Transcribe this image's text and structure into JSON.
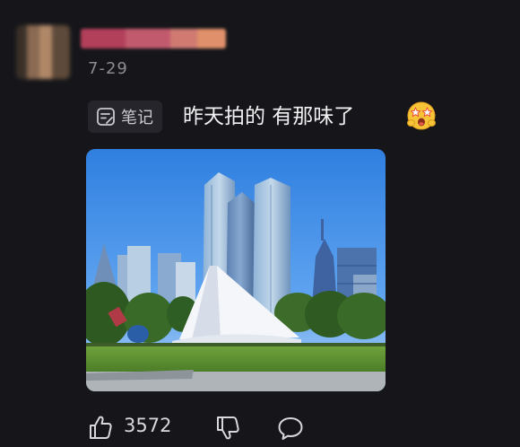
{
  "comment": {
    "date": "7-29",
    "tag_label": "笔记",
    "text": "昨天拍的 有那味了",
    "emoji": "star-struck-emoji"
  },
  "actions": {
    "like_count": "3572"
  },
  "colors": {
    "background": "#16161a",
    "tag_background": "#25252b",
    "text": "#f1f1f3",
    "muted_text": "#8b8b92"
  }
}
